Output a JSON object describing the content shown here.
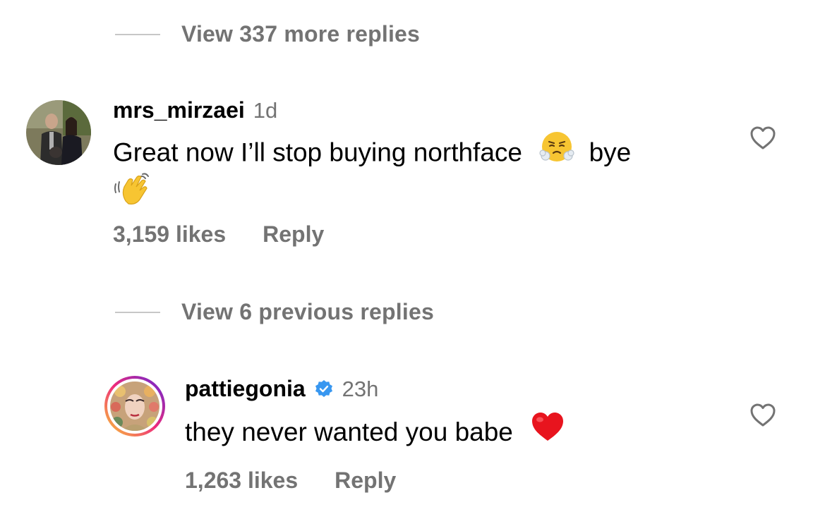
{
  "top_toggle": {
    "label": "View 337 more replies"
  },
  "comment1": {
    "username": "mrs_mirzaei",
    "time": "1d",
    "text_part1": "Great now I’ll stop buying northface",
    "text_part2": "bye",
    "emojis": [
      "face-with-steam-emoji",
      "waving-hand-emoji"
    ],
    "likes": "3,159 likes",
    "reply_label": "Reply"
  },
  "middle_toggle": {
    "label": "View 6 previous replies"
  },
  "comment2": {
    "username": "pattiegonia",
    "verified": true,
    "time": "23h",
    "text": "they never wanted you babe",
    "emojis": [
      "red-heart-emoji"
    ],
    "likes": "1,263 likes",
    "reply_label": "Reply"
  },
  "colors": {
    "secondary_text": "#737373",
    "divider": "#c7c7c7",
    "verified_blue": "#3897f0",
    "heart_red": "#e8141e"
  }
}
